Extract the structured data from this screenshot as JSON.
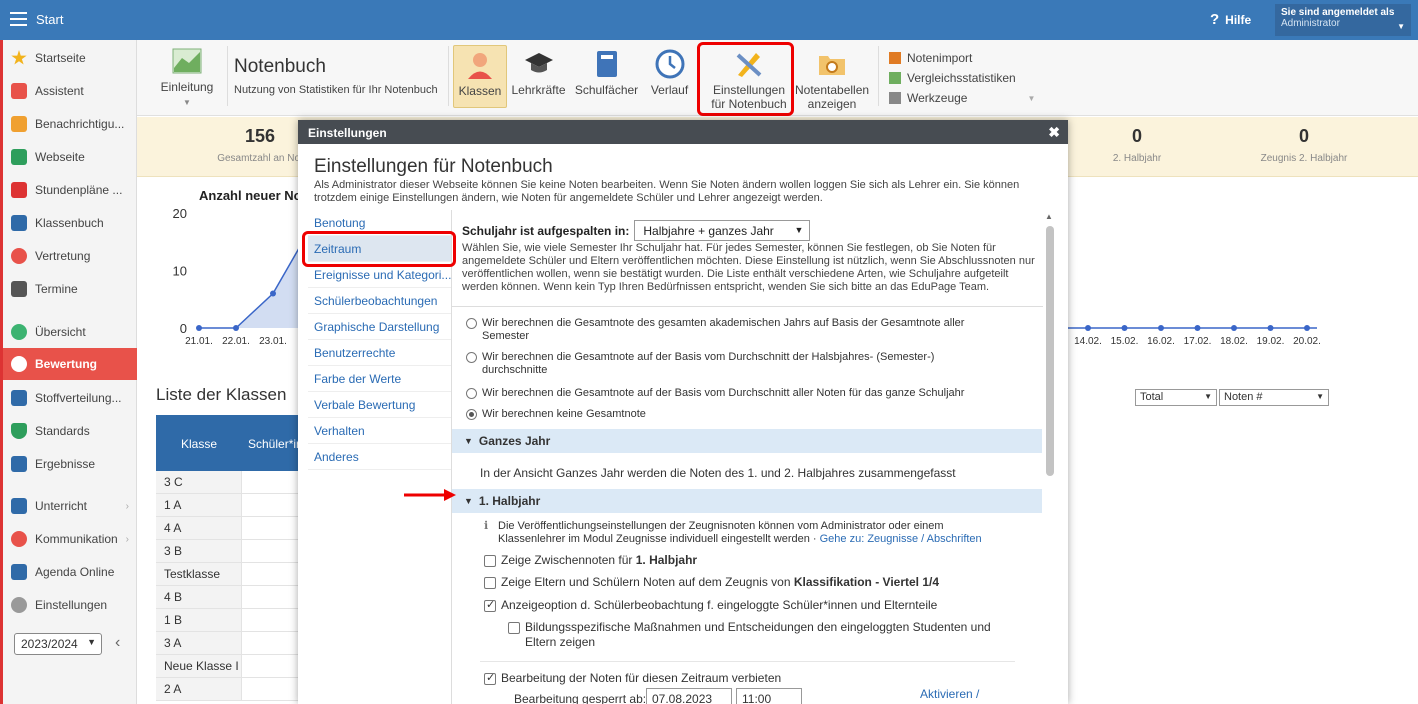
{
  "topbar": {
    "title": "Start",
    "help": "Hilfe",
    "login_line1": "Sie sind angemeldet als",
    "login_line2": "Administrator"
  },
  "sidebar": {
    "items": [
      {
        "label": "Startseite",
        "color": "#f2b31c"
      },
      {
        "label": "Assistent",
        "color": "#e8524a"
      },
      {
        "label": "Benachrichtigu...",
        "color": "#f0a030"
      },
      {
        "label": "Webseite",
        "color": "#2e9e5c"
      },
      {
        "label": "Stundenpläne ...",
        "color": "#d33"
      },
      {
        "label": "Klassenbuch",
        "color": "#2f6aa8"
      },
      {
        "label": "Vertretung",
        "color": "#e8524a"
      },
      {
        "label": "Termine",
        "color": "#555"
      },
      {
        "label": "Übersicht",
        "color": "#3cb371"
      },
      {
        "label": "Bewertung",
        "color": "#ffffff"
      },
      {
        "label": "Stoffverteilung...",
        "color": "#2f6aa8"
      },
      {
        "label": "Standards",
        "color": "#2e9e5c"
      },
      {
        "label": "Ergebnisse",
        "color": "#2f6aa8"
      },
      {
        "label": "Unterricht",
        "color": "#2f6aa8"
      },
      {
        "label": "Kommunikation",
        "color": "#e8524a"
      },
      {
        "label": "Agenda Online",
        "color": "#2f6aa8"
      },
      {
        "label": "Einstellungen",
        "color": "#999"
      }
    ],
    "year": "2023/2024"
  },
  "toolbar": {
    "intro": "Einleitung",
    "title": "Notenbuch",
    "subtitle": "Nutzung von Statistiken für Ihr Notenbuch",
    "buttons": {
      "classes": "Klassen",
      "teachers": "Lehrkräfte",
      "subjects": "Schulfächer",
      "history": "Verlauf",
      "settings_l1": "Einstellungen",
      "settings_l2": "für Notenbuch",
      "tables_l1": "Notentabellen",
      "tables_l2": "anzeigen"
    },
    "side_list": [
      "Notenimport",
      "Vergleichsstatistiken",
      "Werkzeuge"
    ]
  },
  "stats": {
    "total_num": "156",
    "total_label": "Gesamtzahl an Not",
    "h2_num": "0",
    "h2_label": "2. Halbjahr",
    "z2_num": "0",
    "z2_label": "Zeugnis 2. Halbjahr"
  },
  "chart_data": {
    "type": "line",
    "title": "Anzahl neuer No",
    "x_left": [
      "21.01.",
      "22.01.",
      "23.01."
    ],
    "x_right": [
      "14.02.",
      "15.02.",
      "16.02.",
      "17.02.",
      "18.02.",
      "19.02.",
      "20.02."
    ],
    "values_left": [
      0,
      0,
      6
    ],
    "values_right": [
      0,
      0,
      0,
      0,
      0,
      0,
      0
    ],
    "yticks": [
      "20",
      "10",
      "0"
    ],
    "ylim": [
      0,
      20
    ]
  },
  "classlist": {
    "title": "Liste der Klassen",
    "col1": "Klasse",
    "col2": "Schüler*in",
    "rows": [
      "3 C",
      "1 A",
      "4 A",
      "3 B",
      "Testklasse",
      "4 B",
      "1 B",
      "3 A",
      "Neue Klasse I",
      "2 A"
    ],
    "select_total": "Total",
    "select_noten": "Noten #"
  },
  "modal": {
    "header": "Einstellungen",
    "title": "Einstellungen für Notenbuch",
    "desc": "Als Administrator dieser Webseite können Sie keine Noten bearbeiten. Wenn Sie Noten ändern wollen loggen Sie sich als Lehrer ein. Sie können trotzdem einige Einstellungen ändern, wie Noten für angemeldete Schüler und Lehrer angezeigt werden.",
    "nav": [
      "Benotung",
      "Zeitraum",
      "Ereignisse und Kategori...",
      "Schülerbeobachtungen",
      "Graphische Darstellung",
      "Benutzerrechte",
      "Farbe der Werte",
      "Verbale Bewertung",
      "Verhalten",
      "Anderes"
    ],
    "split_label": "Schuljahr ist aufgespalten in:",
    "split_value": "Halbjahre + ganzes Jahr",
    "split_desc": "Wählen Sie, wie viele Semester Ihr Schuljahr hat. Für jedes Semester, können Sie festlegen, ob Sie Noten für angemeldete Schüler und Eltern veröffentlichen möchten. Diese Einstellung ist nützlich, wenn Sie Abschlussnoten nur veröffentlichen wollen, wenn sie bestätigt wurden. Die Liste enthält verschiedene Arten, wie Schuljahre aufgeteilt werden können. Wenn kein Typ Ihren Bedürfnissen entspricht, wenden Sie sich bitte an das EduPage Team.",
    "radios": [
      "Wir berechnen die Gesamtnote des gesamten akademischen Jahrs auf Basis der Gesamtnote aller Semester",
      "Wir berechnen die Gesamtnote auf der Basis vom Durchschnitt der Halsbjahres- (Semester-) durchschnitte",
      "Wir berechnen die Gesamtnote auf der Basis vom Durchschnitt aller Noten für das ganze Schuljahr",
      "Wir berechnen keine Gesamtnote"
    ],
    "sec_year": "Ganzes Jahr",
    "year_text": "In der Ansicht Ganzes Jahr werden die Noten des 1. und 2. Halbjahres zusammengefasst",
    "sec_h1": "1. Halbjahr",
    "info_text": "Die Veröffentlichungseinstellungen der Zeugnisnoten können vom Administrator oder einem Klassenlehrer im Modul Zeugnisse individuell eingestellt werden",
    "info_link": "Gehe zu: Zeugnisse / Abschriften",
    "cb1_pre": "Zeige Zwischennoten für",
    "cb1_bold": "1. Halbjahr",
    "cb2_pre": "Zeige Eltern und Schülern Noten auf dem Zeugnis von",
    "cb2_bold": "Klassifikation - Viertel 1/4",
    "cb3": "Anzeigeoption d. Schülerbeobachtung f. eingeloggte Schüler*innen und Elternteile",
    "cb4": "Bildungsspezifische Maßnahmen und Entscheidungen den eingeloggten Studenten und Eltern zeigen",
    "cb5": "Bearbeitung der Noten für diesen Zeitraum verbieten",
    "locked_label": "Bearbeitung gesperrt ab:",
    "locked_date": "07.08.2023",
    "locked_time": "11:00",
    "activate": "Aktivieren /"
  }
}
